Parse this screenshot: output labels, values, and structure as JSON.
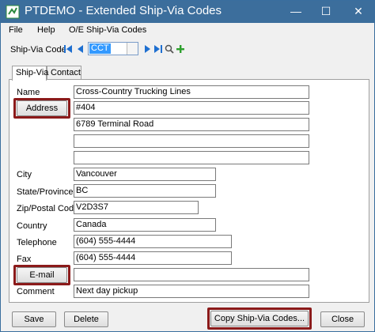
{
  "window": {
    "title": "PTDEMO - Extended Ship-Via Codes",
    "controls": {
      "minimize": "—",
      "maximize": "☐",
      "close": "✕"
    }
  },
  "menu": [
    {
      "label": "File"
    },
    {
      "label": "Help"
    },
    {
      "label": "O/E Ship-Via Codes"
    }
  ],
  "code_bar": {
    "label": "Ship-Via Code",
    "value": "CCT"
  },
  "tabs": [
    {
      "label": "Ship-Via",
      "active": true
    },
    {
      "label": "Contact",
      "active": false
    }
  ],
  "form": {
    "name_label": "Name",
    "name_value": "Cross-Country Trucking Lines",
    "address_button": "Address",
    "address_lines": [
      "#404",
      "6789 Terminal Road",
      "",
      ""
    ],
    "city_label": "City",
    "city_value": "Vancouver",
    "state_label": "State/Province",
    "state_value": "BC",
    "zip_label": "Zip/Postal Code",
    "zip_value": "V2D3S7",
    "country_label": "Country",
    "country_value": "Canada",
    "telephone_label": "Telephone",
    "telephone_value": "(604) 555-4444",
    "fax_label": "Fax",
    "fax_value": "(604) 555-4444",
    "email_button": "E-mail",
    "email_value": "",
    "comment_label": "Comment",
    "comment_value": "Next day pickup"
  },
  "footer": {
    "save": "Save",
    "delete": "Delete",
    "copy": "Copy Ship-Via Codes...",
    "close": "Close"
  },
  "colors": {
    "titlebar": "#3c6e9c",
    "highlight": "#8b1a1a",
    "selection": "#3399ff",
    "nav_arrow": "#1e6fd0",
    "add_icon": "#2ea02e"
  },
  "icons": [
    "app-icon",
    "first-record-icon",
    "previous-record-icon",
    "next-record-icon",
    "last-record-icon",
    "search-icon",
    "add-icon"
  ]
}
